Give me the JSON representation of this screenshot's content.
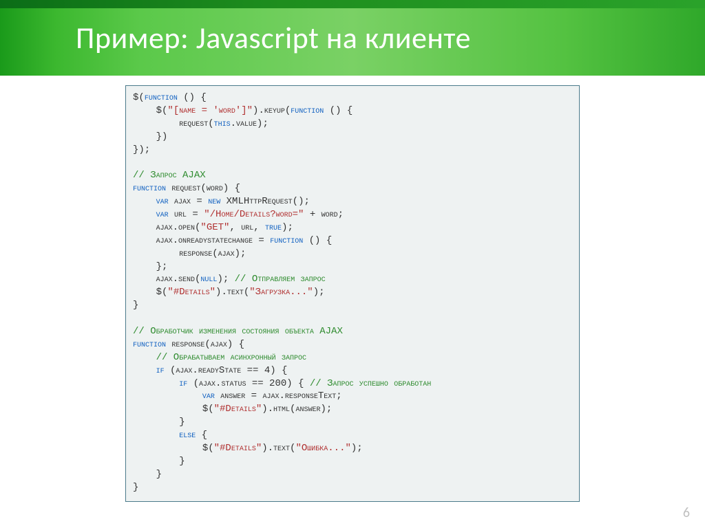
{
  "slide": {
    "title": "Пример: Javascript на клиенте",
    "page_number": "6"
  },
  "code": {
    "l01a": "$(",
    "l01b": "function",
    "l01c": " () {",
    "l02a": "    $(",
    "l02b": "\"[name = 'word']\"",
    "l02c": ").keyup(",
    "l02d": "function",
    "l02e": " () {",
    "l03a": "        request(",
    "l03b": "this",
    "l03c": ".value);",
    "l04": "    })",
    "l05": "});",
    "l06": "",
    "l07": "// Запрос AJAX",
    "l08a": "function",
    "l08b": " request(word) {",
    "l09a": "    ",
    "l09b": "var",
    "l09c": " ajax = ",
    "l09d": "new",
    "l09e": " XMLHttpRequest();",
    "l10a": "    ",
    "l10b": "var",
    "l10c": " url = ",
    "l10d": "\"/Home/Details?word=\"",
    "l10e": " + word;",
    "l11a": "    ajax.open(",
    "l11b": "\"GET\"",
    "l11c": ", url, ",
    "l11d": "true",
    "l11e": ");",
    "l12a": "    ajax.onreadystatechange = ",
    "l12b": "function",
    "l12c": " () {",
    "l13": "        response(ajax);",
    "l14": "    };",
    "l15a": "    ajax.send(",
    "l15b": "null",
    "l15c": "); ",
    "l15d": "// Отправляем запрос",
    "l16a": "    $(",
    "l16b": "\"#Details\"",
    "l16c": ").text(",
    "l16d": "\"Загрузка...\"",
    "l16e": ");",
    "l17": "}",
    "l18": "",
    "l19": "// Обработчик изменения состояния объекта AJAX",
    "l20a": "function",
    "l20b": " response(ajax) {",
    "l21": "    // Обрабатываем асинхронный запрос",
    "l22a": "    ",
    "l22b": "if",
    "l22c": " (ajax.readyState == 4) {",
    "l23a": "        ",
    "l23b": "if",
    "l23c": " (ajax.status == 200) { ",
    "l23d": "// Запрос успешно обработан",
    "l24a": "            ",
    "l24b": "var",
    "l24c": " answer = ajax.responseText;",
    "l25a": "            $(",
    "l25b": "\"#Details\"",
    "l25c": ").html(answer);",
    "l26": "        }",
    "l27a": "        ",
    "l27b": "else",
    "l27c": " {",
    "l28a": "            $(",
    "l28b": "\"#Details\"",
    "l28c": ").text(",
    "l28d": "\"Ошибка...\"",
    "l28e": ");",
    "l29": "        }",
    "l30": "    }",
    "l31": "}"
  }
}
